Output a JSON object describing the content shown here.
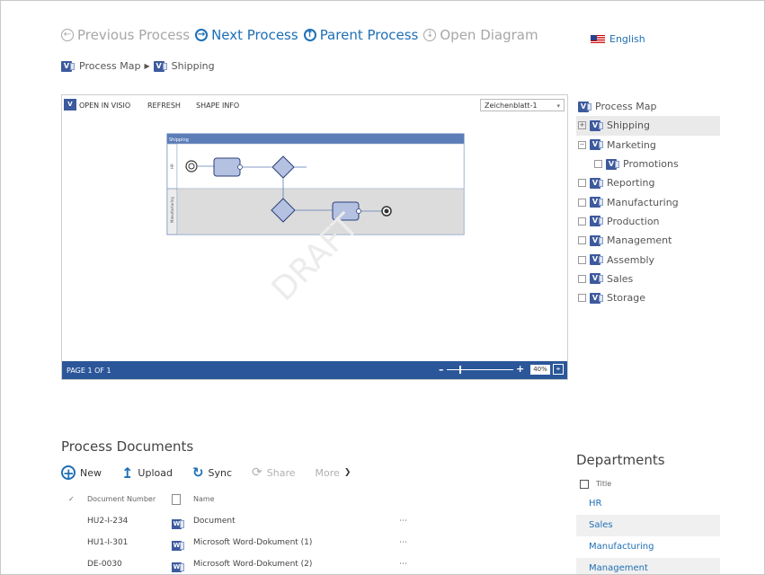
{
  "nav": {
    "previous": "Previous Process",
    "next": "Next Process",
    "parent": "Parent Process",
    "open_diagram": "Open Diagram"
  },
  "language": "English",
  "breadcrumb": [
    "Process Map",
    "Shipping"
  ],
  "viewer": {
    "open_in_visio": "OPEN IN VISIO",
    "refresh": "REFRESH",
    "shape_info": "SHAPE INFO",
    "sheet": "Zeichenblatt-1",
    "page_label": "PAGE 1 OF 1",
    "zoom": "40%",
    "watermark": "DRAFT",
    "diagram": {
      "pool_title": "Shipping",
      "lanes": [
        "HR",
        "Manufacturing"
      ]
    }
  },
  "tree": {
    "root": "Process Map",
    "items": [
      {
        "label": "Shipping",
        "selected": true,
        "indent": 0
      },
      {
        "label": "Marketing",
        "selected": false,
        "indent": 0
      },
      {
        "label": "Promotions",
        "selected": false,
        "indent": 1
      },
      {
        "label": "Reporting",
        "selected": false,
        "indent": 0
      },
      {
        "label": "Manufacturing",
        "selected": false,
        "indent": 0
      },
      {
        "label": "Production",
        "selected": false,
        "indent": 0
      },
      {
        "label": "Management",
        "selected": false,
        "indent": 0
      },
      {
        "label": "Assembly",
        "selected": false,
        "indent": 0
      },
      {
        "label": "Sales",
        "selected": false,
        "indent": 0
      },
      {
        "label": "Storage",
        "selected": false,
        "indent": 0
      }
    ]
  },
  "process_documents": {
    "title": "Process Documents",
    "toolbar": {
      "new": "New",
      "upload": "Upload",
      "sync": "Sync",
      "share": "Share",
      "more": "More"
    },
    "columns": {
      "number": "Document Number",
      "name": "Name"
    },
    "rows": [
      {
        "number": "HU2-I-234",
        "name": "Document"
      },
      {
        "number": "HU1-I-301",
        "name": "Microsoft Word-Dokument (1)"
      },
      {
        "number": "DE-0030",
        "name": "Microsoft Word-Dokument (2)"
      }
    ]
  },
  "departments": {
    "title": "Departments",
    "column": "Title",
    "rows": [
      "HR",
      "Sales",
      "Manufacturing",
      "Management"
    ]
  },
  "colors": {
    "accent": "#1e6fb5",
    "visio_blue": "#2b579a"
  }
}
